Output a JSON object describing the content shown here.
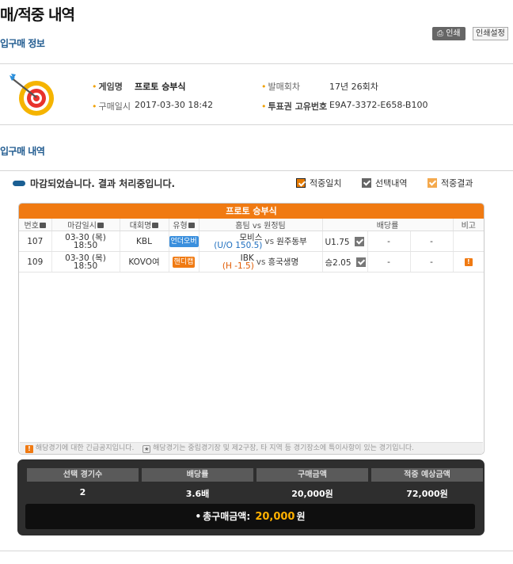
{
  "header": {
    "title": "매/적중 내역",
    "print_label": "인쇄",
    "print_settings_label": "인쇄설정"
  },
  "purchase_info": {
    "section_title": "입구매 정보",
    "game_name_label": "게임명",
    "game_name": "프로토 승부식",
    "purchase_datetime_label": "구매일시",
    "purchase_datetime": "2017-03-30 18:42",
    "round_label": "발매회차",
    "round": "17년 26회차",
    "ticket_id_label": "투표권 고유번호",
    "ticket_id": "E9A7-3372-E658-B100"
  },
  "purchase_details": {
    "section_title": "입구매 내역",
    "status_text": "마감되었습니다. 결과 처리중입니다.",
    "legend": [
      {
        "label": "적중일치",
        "color": "#e57a00"
      },
      {
        "label": "선택내역",
        "color": "#666666"
      },
      {
        "label": "적중결과",
        "color": "#f4a94d"
      }
    ]
  },
  "table": {
    "game_title": "프로토 승부식",
    "columns": {
      "number": "번호",
      "deadline": "마감일시",
      "league": "대회명",
      "type": "유형",
      "matchup": "홈팀 vs 원정팀",
      "odds": "배당률",
      "note": "비고"
    },
    "rows": [
      {
        "number": "107",
        "date": "03-30 (목)",
        "time": "18:50",
        "league": "KBL",
        "type": "언더오버",
        "type_color": "#3a8fdd",
        "home": "모비스",
        "home_sub": "(U/O 150.5)",
        "home_sub_color": "#1f6fbf",
        "vs": "vs",
        "away": "원주동부",
        "odds_pick": "U1.75",
        "odds_2": "-",
        "odds_3": "-",
        "has_alert": false
      },
      {
        "number": "109",
        "date": "03-30 (목)",
        "time": "18:50",
        "league": "KOVO여",
        "type": "핸디캡",
        "type_color": "#f07a12",
        "home": "IBK",
        "home_sub": "(H -1.5)",
        "home_sub_color": "#e05a00",
        "vs": "vs",
        "away": "흥국생명",
        "odds_pick": "승2.05",
        "odds_2": "-",
        "odds_3": "-",
        "has_alert": true
      }
    ],
    "notice_alert": "해당경기에 대한 긴급공지입니다.",
    "notice_star": "해당경기는 중립경기장 및 제2구장, 타 지역 등 경기장소에 특이사항이 있는 경기입니다."
  },
  "summary": {
    "labels": [
      "선택 경기수",
      "배당률",
      "구매금액",
      "적중 예상금액"
    ],
    "values": [
      "2",
      "3.6배",
      "20,000원",
      "72,000원"
    ],
    "total_label": "총구매금액:",
    "total_amount": "20,000",
    "total_unit": "원"
  }
}
